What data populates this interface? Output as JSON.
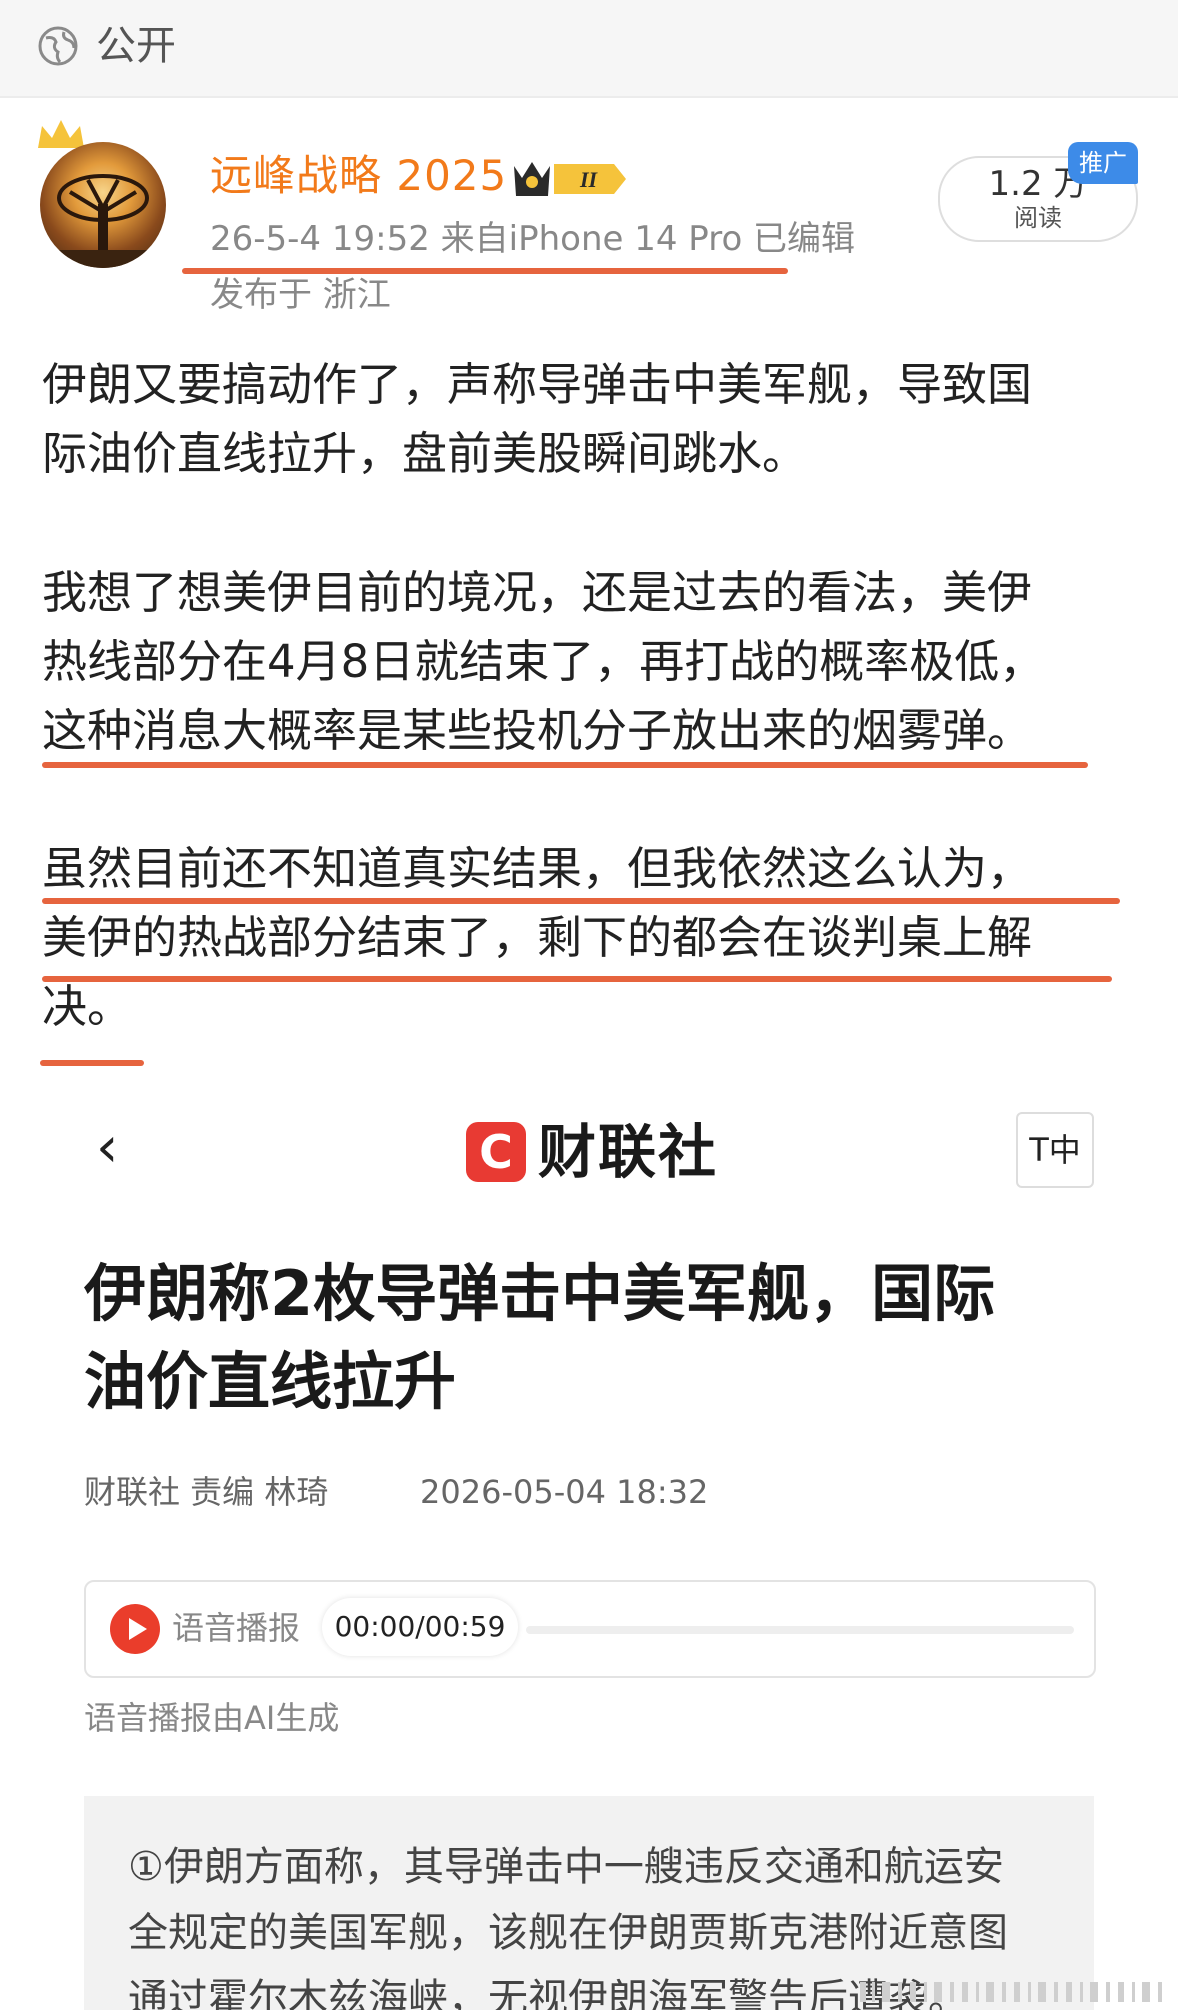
{
  "visibility": {
    "icon": "globe-icon",
    "label": "公开"
  },
  "author": {
    "name": "远峰战略 2025",
    "badge_level": "II",
    "meta": "26-5-4 19:52  来自iPhone 14 Pro  已编辑",
    "location": "发布于 浙江"
  },
  "stats": {
    "reads_count": "1.2 万",
    "reads_label": "阅读",
    "promo_tag": "推广"
  },
  "post": {
    "paragraphs": [
      "伊朗又要搞动作了，声称导弹击中美军舰，导致国\n际油价直线拉升，盘前美股瞬间跳水。",
      "我想了想美伊目前的境况，还是过去的看法，美伊\n热线部分在4月8日就结束了，再打战的概率极低，\n这种消息大概率是某些投机分子放出来的烟雾弹。",
      "虽然目前还不知道真实结果，但我依然这么认为，\n美伊的热战部分结束了，剩下的都会在谈判桌上解\n决。"
    ]
  },
  "news": {
    "back_icon": "chevron-left-icon",
    "logo_mark": "C",
    "logo_text": "财联社",
    "font_button": "T中",
    "headline": "伊朗称2枚导弹击中美军舰，国际\n油价直线拉升",
    "byline": "财联社  责编 林琦",
    "date": "2026-05-04 18:32",
    "audio": {
      "label": "语音播报",
      "time": "00:00/00:59",
      "progress": 0
    },
    "ai_note": "语音播报由AI生成",
    "summary": "①伊朗方面称，其导弹击中一艘违反交通和航运安\n全规定的美国军舰，该舰在伊朗贾斯克港附近意图\n通过霍尔木兹海峡，无视伊朗海军警告后遭袭。"
  },
  "colors": {
    "accent": "#f27a1a",
    "underline": "#e6643e",
    "promo": "#3d8be8",
    "news_red": "#e83a33"
  }
}
